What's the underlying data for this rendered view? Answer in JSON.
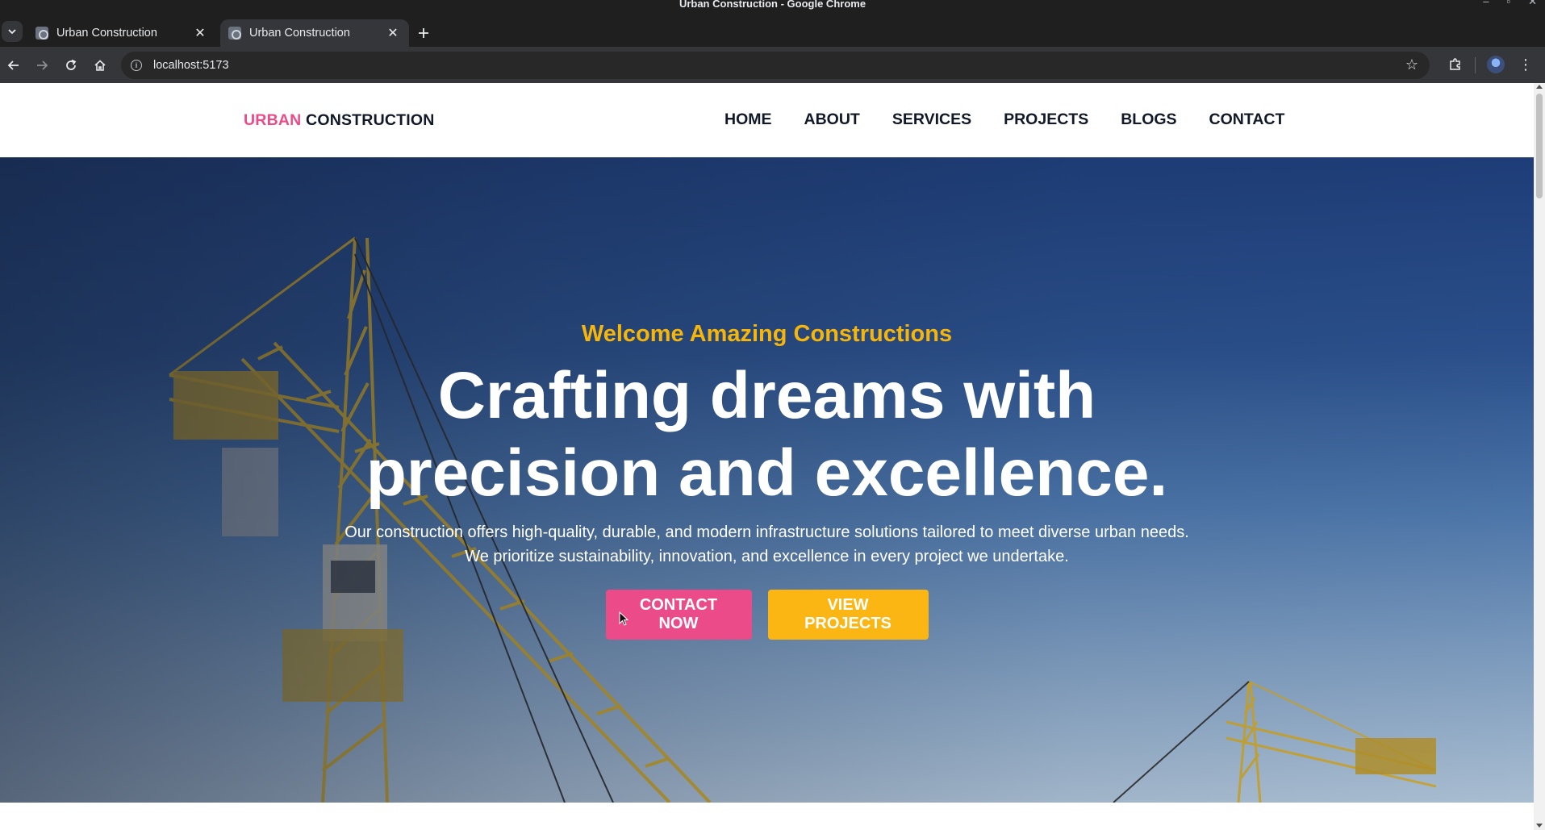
{
  "window": {
    "title": "Urban Construction - Google Chrome"
  },
  "tabs": [
    {
      "title": "Urban Construction",
      "active": false
    },
    {
      "title": "Urban Construction",
      "active": true
    }
  ],
  "toolbar": {
    "url": "localhost:5173"
  },
  "site": {
    "brand_accent": "URBAN",
    "brand_rest": "CONSTRUCTION",
    "nav": [
      "HOME",
      "ABOUT",
      "SERVICES",
      "PROJECTS",
      "BLOGS",
      "CONTACT"
    ]
  },
  "hero": {
    "eyebrow": "Welcome Amazing Constructions",
    "headline_line1": "Crafting dreams with",
    "headline_line2": "precision and excellence.",
    "subtext_line1": "Our construction offers high-quality, durable, and modern infrastructure solutions tailored to meet diverse urban needs.",
    "subtext_line2": "We prioritize sustainability, innovation, and excellence in every project we undertake.",
    "cta_primary": "CONTACT NOW",
    "cta_secondary": "VIEW PROJECTS"
  },
  "colors": {
    "brand_accent": "#ec4b8a",
    "eyebrow": "#f5b50a",
    "cta_primary_bg": "#ec4b8a",
    "cta_secondary_bg": "#fbb614"
  },
  "icons": {
    "tab_search": "chevron-down-icon",
    "new_tab": "plus-icon",
    "back": "arrow-left-icon",
    "forward": "arrow-right-icon",
    "reload": "reload-icon",
    "home": "home-icon",
    "site_info": "info-icon",
    "bookmark": "star-icon",
    "extensions": "puzzle-icon",
    "menu": "kebab-menu-icon"
  }
}
